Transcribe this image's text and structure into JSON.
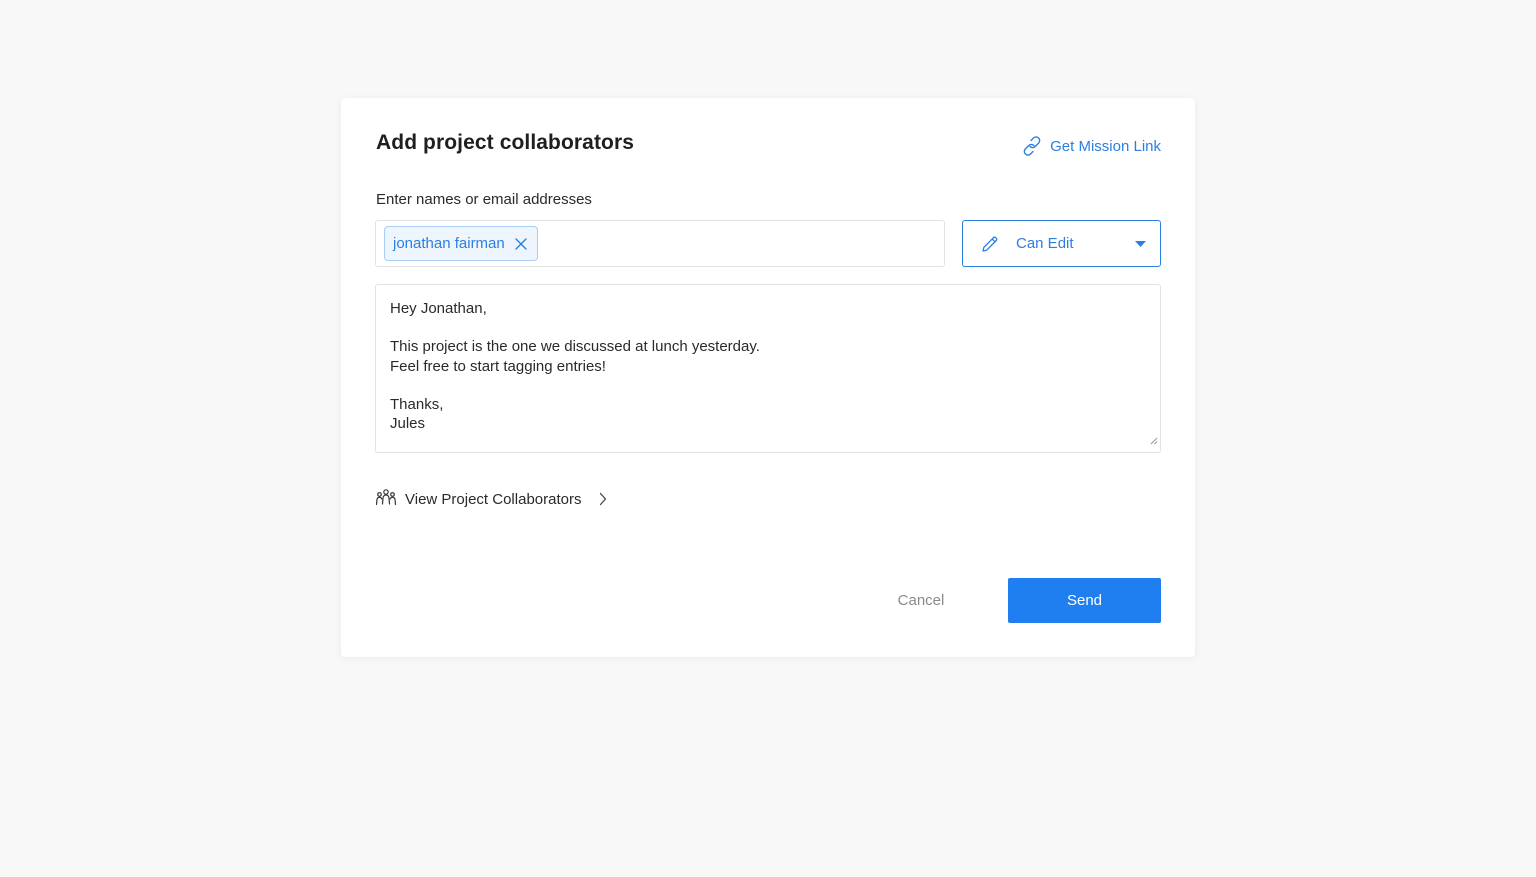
{
  "dialog": {
    "title": "Add project collaborators",
    "mission_link_label": "Get Mission Link",
    "field_label": "Enter names or email addresses",
    "recipients": [
      {
        "name": "jonathan fairman"
      }
    ],
    "permission": {
      "selected": "Can Edit"
    },
    "message_lines": [
      "Hey Jonathan,",
      "",
      "This project is the one we discussed at lunch yesterday.",
      "Feel free to start tagging entries!",
      "",
      "Thanks,",
      "Jules"
    ],
    "view_collaborators_label": "View Project Collaborators",
    "cancel_label": "Cancel",
    "send_label": "Send"
  },
  "icons": {
    "mission_link": "link-icon",
    "chip_remove": "close-icon",
    "permission": "pencil-icon",
    "permission_caret": "caret-down-icon",
    "collaborators": "people-icon",
    "view_chevron": "chevron-right-icon"
  },
  "colors": {
    "accent": "#2b7fe0",
    "primary_button": "#1f7ff0",
    "chip_background": "#eef5fd",
    "chip_border": "#a9cdf5",
    "page_background": "#f8f8f8"
  }
}
